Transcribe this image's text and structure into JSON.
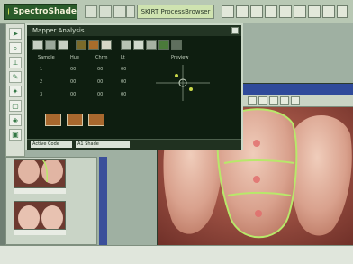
{
  "app": {
    "logo_text": "SpectroShade",
    "window_title": "SKIRT ProcessBrowser"
  },
  "toolbar": {
    "left_icons": [
      "pointer-icon",
      "grid-icon",
      "page-icon",
      "paint-icon"
    ],
    "right_icons": [
      "window-icon",
      "home-icon",
      "folder-icon",
      "chart-icon",
      "print-icon",
      "globe-icon",
      "info-icon",
      "help-icon"
    ]
  },
  "dialog": {
    "title": "Mapper Analysis",
    "headers": [
      "Sample",
      "Hue",
      "Chrm",
      "Lt",
      "Preview"
    ],
    "rows": [
      {
        "label": "1",
        "v1": "00",
        "v2": "00",
        "v3": "00"
      },
      {
        "label": "2",
        "v1": "00",
        "v2": "00",
        "v3": "00"
      },
      {
        "label": "3",
        "v1": "00",
        "v2": "00",
        "v3": "00"
      }
    ],
    "status_left": "Active Code",
    "status_right": "A1 Shade"
  },
  "thumbnails": {
    "labels": [
      "",
      ""
    ]
  },
  "colors": {
    "accent_blue": "#2f4a9a",
    "dialog_bg": "#0e1e10",
    "swatch": "#a8682e"
  },
  "statusbar": {
    "text": ""
  }
}
